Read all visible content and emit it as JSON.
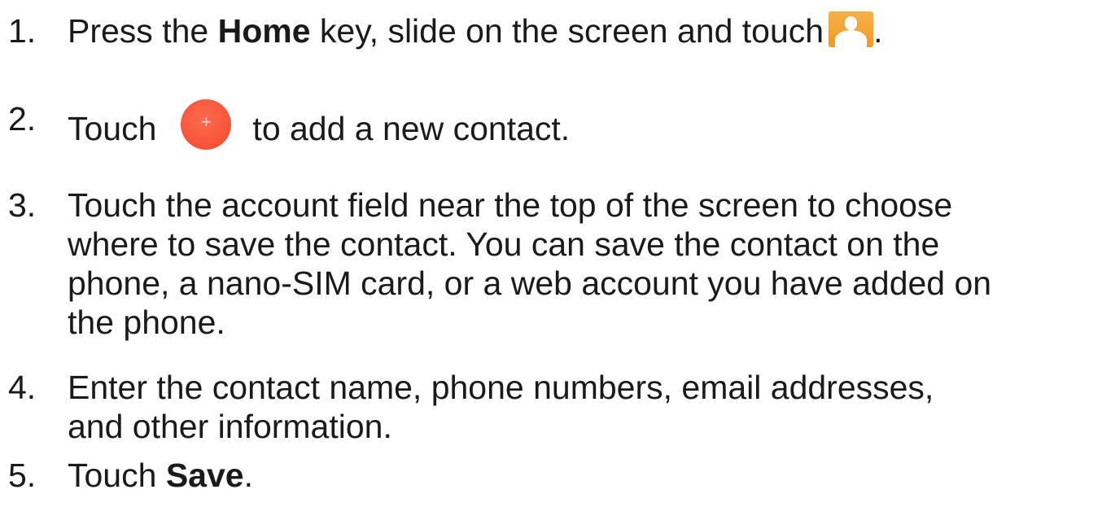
{
  "steps": [
    {
      "number": "1.",
      "parts": {
        "a": "Press the ",
        "b_bold": "Home",
        "c": " key, slide on the screen and touch",
        "d": "."
      },
      "icon": "contacts-app-icon"
    },
    {
      "number": "2.",
      "parts": {
        "a": "Touch",
        "c": "to add a new contact."
      },
      "icon": "add-contact-fab-icon",
      "icon_glyph": "+"
    },
    {
      "number": "3.",
      "lines": [
        "Touch the account field near the top of the screen to choose",
        "where to save the contact. You can save the contact on the",
        "phone, a nano-SIM card, or a web account you have added on",
        "the phone."
      ]
    },
    {
      "number": "4.",
      "lines": [
        "Enter the contact name, phone numbers, email addresses,",
        "and other information."
      ]
    },
    {
      "number": "5.",
      "parts": {
        "a": "Touch ",
        "b_bold": "Save",
        "d": "."
      }
    }
  ],
  "colors": {
    "text": "#1a1a1a",
    "fab": "#f2492f",
    "contacts_icon": "#ef9a24"
  }
}
